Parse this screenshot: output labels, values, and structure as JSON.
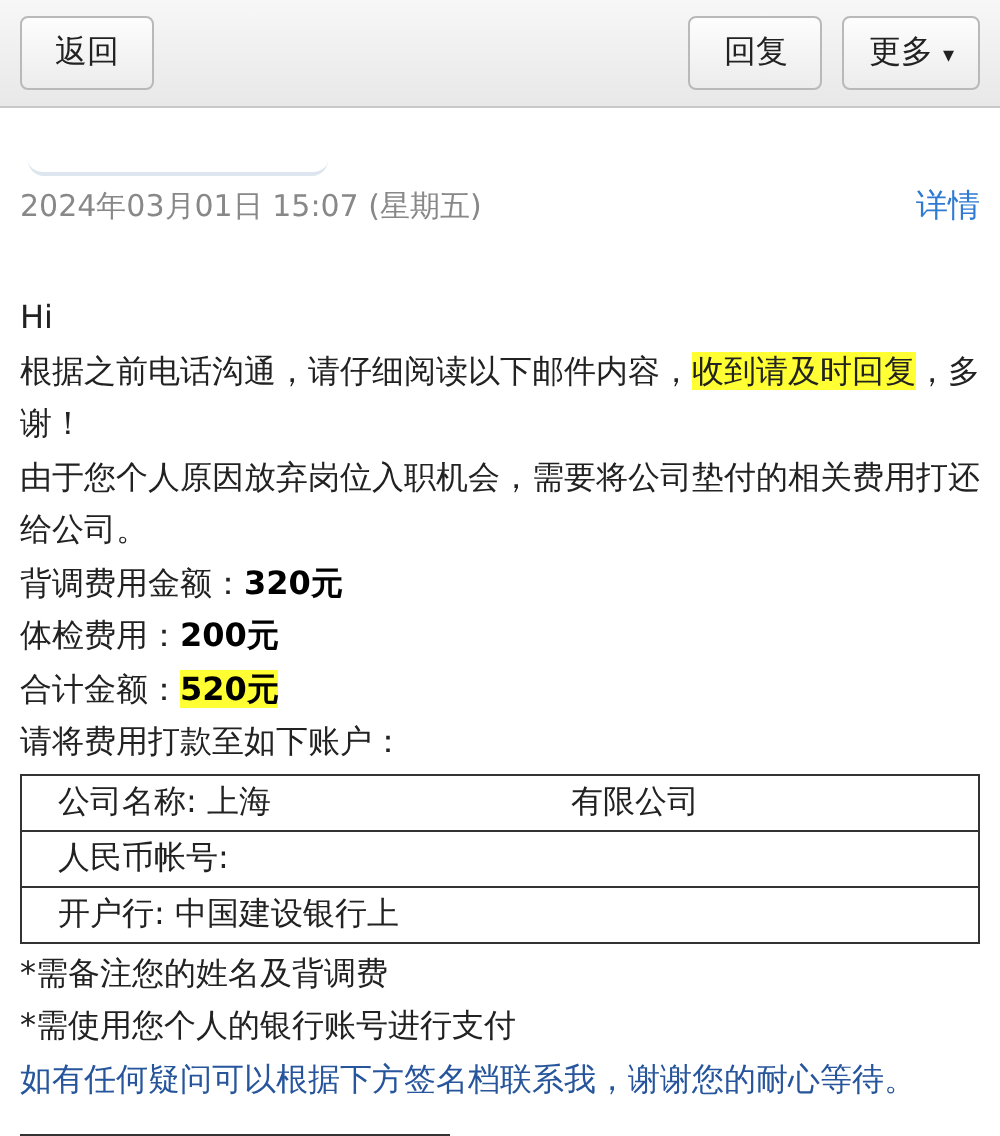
{
  "toolbar": {
    "back": "返回",
    "reply": "回复",
    "more": "更多",
    "more_caret": "▾"
  },
  "header": {
    "date": "2024年03月01日 15:07 (星期五)",
    "details": "详情"
  },
  "body": [
    {
      "kind": "text",
      "segments": [
        {
          "text": "Hi",
          "bold": false,
          "highlight": false
        }
      ]
    },
    {
      "kind": "text",
      "segments": [
        {
          "text": "根据之前电话沟通，请仔细阅读以下邮件内容，",
          "bold": false,
          "highlight": false
        },
        {
          "text": "收到请及时回复",
          "bold": false,
          "highlight": true
        },
        {
          "text": "，多谢！",
          "bold": false,
          "highlight": false
        }
      ]
    },
    {
      "kind": "text",
      "segments": [
        {
          "text": "由于您个人原因放弃岗位入职机会，需要将公司垫付的相关费用打还给公司。",
          "bold": false,
          "highlight": false
        }
      ]
    },
    {
      "kind": "text",
      "segments": [
        {
          "text": "背调费用金额：",
          "bold": false,
          "highlight": false
        },
        {
          "text": "320元",
          "bold": true,
          "highlight": false
        }
      ]
    },
    {
      "kind": "text",
      "segments": [
        {
          "text": "体检费用：",
          "bold": false,
          "highlight": false
        },
        {
          "text": "200元",
          "bold": true,
          "highlight": false
        }
      ]
    },
    {
      "kind": "text",
      "segments": [
        {
          "text": "合计金额：",
          "bold": false,
          "highlight": false
        },
        {
          "text": "520元",
          "bold": true,
          "highlight": true
        }
      ]
    },
    {
      "kind": "text",
      "segments": [
        {
          "text": "请将费用打款至如下账户：",
          "bold": false,
          "highlight": false
        }
      ]
    },
    {
      "kind": "table",
      "rows": [
        {
          "label": "公司名称: 上海",
          "tail": "有限公司"
        },
        {
          "label": "人民币帐号:"
        },
        {
          "label": "开户行: 中国建设银行上"
        }
      ]
    },
    {
      "kind": "text",
      "segments": [
        {
          "text": "*需备注您的姓名及背调费",
          "bold": false,
          "highlight": false
        }
      ]
    },
    {
      "kind": "text",
      "segments": [
        {
          "text": "*需使用您个人的银行账号进行支付",
          "bold": false,
          "highlight": false
        }
      ]
    },
    {
      "kind": "note",
      "segments": [
        {
          "text": "如有任何疑问可以根据下方签名档联系我，谢谢您的耐心等待。",
          "bold": false,
          "highlight": false
        }
      ]
    }
  ]
}
